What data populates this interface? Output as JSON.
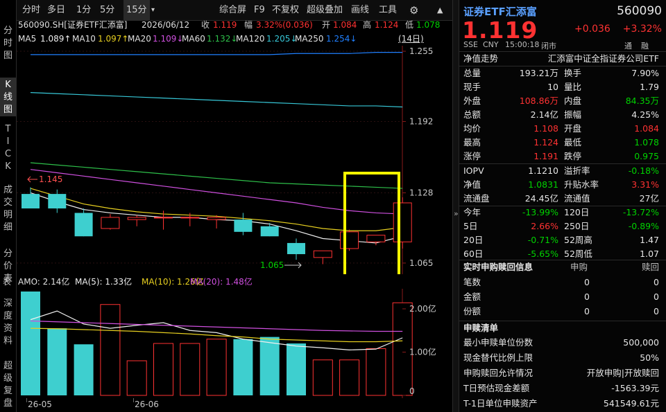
{
  "vtabs": [
    "分时图",
    "K线图",
    "TICK",
    "成交明细",
    "分价表",
    "深度资料",
    "超级复盘"
  ],
  "toolbar": {
    "items": [
      "分时",
      "多日",
      "1分",
      "5分",
      "15分",
      "▾",
      "综合屏",
      "F9",
      "不复权",
      "超级叠加",
      "画线",
      "工具"
    ],
    "gear": "⚙",
    "up": "▲"
  },
  "info": {
    "code": "560090.SH[证券ETF汇添富]",
    "date": "2026/06/12",
    "close_l": "收",
    "close": "1.119",
    "chg_l": "幅",
    "chg": "3.32%(0.036)",
    "open_l": "开",
    "open": "1.084",
    "high_l": "高",
    "high": "1.124",
    "low_l": "低",
    "low": "1.078"
  },
  "ma": {
    "ma5": "MA5",
    "ma5v": "1.089↑",
    "ma10": "MA10",
    "ma10v": "1.097↑",
    "ma20": "MA20",
    "ma20v": "1.109↓",
    "ma60": "MA60",
    "ma60v": "1.132↓",
    "ma120": "MA120",
    "ma120v": "1.205↓",
    "ma250": "MA250",
    "ma250v": "1.254↓",
    "days": "(14日)"
  },
  "price_axis": [
    "1.255",
    "1.192",
    "1.128",
    "1.065"
  ],
  "annot": {
    "hi": "1.145",
    "lo": "1.065"
  },
  "vol": {
    "amo": "AMO: 2.14亿",
    "ma5": "MA(5): 1.33亿",
    "ma10": "MA(10): 1.26亿",
    "ma20": "MA(20): 1.48亿",
    "axis": [
      "2.00亿",
      "1.00亿",
      "0"
    ]
  },
  "xaxis": [
    "26-05",
    "26-06"
  ],
  "chart_data": {
    "type": "candlestick",
    "y_range": [
      1.055,
      1.26
    ],
    "candles": [
      {
        "o": 1.127,
        "h": 1.133,
        "l": 1.117,
        "c": 1.114,
        "v": 2.4
      },
      {
        "o": 1.127,
        "h": 1.131,
        "l": 1.11,
        "c": 1.114,
        "v": 1.55
      },
      {
        "o": 1.11,
        "h": 1.114,
        "l": 1.089,
        "c": 1.089,
        "v": 1.18
      },
      {
        "o": 1.096,
        "h": 1.109,
        "l": 1.095,
        "c": 1.106,
        "v": 2.1
      },
      {
        "o": 1.104,
        "h": 1.108,
        "l": 1.098,
        "c": 1.106,
        "v": 0.8
      },
      {
        "o": 1.106,
        "h": 1.112,
        "l": 1.095,
        "c": 1.106,
        "v": 1.2
      },
      {
        "o": 1.106,
        "h": 1.11,
        "l": 1.098,
        "c": 1.106,
        "v": 1.2
      },
      {
        "o": 1.104,
        "h": 1.108,
        "l": 1.096,
        "c": 1.106,
        "v": 1.3
      },
      {
        "o": 1.104,
        "h": 1.11,
        "l": 1.09,
        "c": 1.093,
        "v": 1.3
      },
      {
        "o": 1.098,
        "h": 1.101,
        "l": 1.089,
        "c": 1.089,
        "v": 1.35
      },
      {
        "o": 1.083,
        "h": 1.087,
        "l": 1.068,
        "c": 1.073,
        "v": 1.2
      },
      {
        "o": 1.07,
        "h": 1.076,
        "l": 1.064,
        "c": 1.076,
        "v": 0.82
      },
      {
        "o": 1.078,
        "h": 1.095,
        "l": 1.076,
        "c": 1.093,
        "v": 0.82
      },
      {
        "o": 1.084,
        "h": 1.09,
        "l": 1.081,
        "c": 1.09,
        "v": 1.08
      },
      {
        "o": 1.084,
        "h": 1.124,
        "l": 1.078,
        "c": 1.119,
        "v": 2.14
      }
    ],
    "ma_lines": [
      {
        "name": "MA250",
        "color": "#2080ff",
        "values": [
          1.252,
          1.252,
          1.252,
          1.252,
          1.252,
          1.252,
          1.252,
          1.252,
          1.252,
          1.252,
          1.253,
          1.253,
          1.253,
          1.254,
          1.254
        ]
      },
      {
        "name": "MA120",
        "color": "#37c8d8",
        "values": [
          1.218,
          1.217,
          1.216,
          1.215,
          1.214,
          1.213,
          1.212,
          1.211,
          1.21,
          1.209,
          1.208,
          1.207,
          1.206,
          1.206,
          1.205
        ]
      },
      {
        "name": "MA60",
        "color": "#2ec04a",
        "values": [
          1.155,
          1.153,
          1.151,
          1.149,
          1.147,
          1.145,
          1.143,
          1.141,
          1.139,
          1.137,
          1.136,
          1.135,
          1.134,
          1.133,
          1.132
        ]
      },
      {
        "name": "MA20",
        "color": "#d050e0",
        "values": [
          1.149,
          1.146,
          1.143,
          1.14,
          1.137,
          1.134,
          1.131,
          1.128,
          1.125,
          1.122,
          1.119,
          1.115,
          1.112,
          1.11,
          1.109
        ]
      },
      {
        "name": "MA10",
        "color": "#e8d020",
        "values": [
          1.132,
          1.125,
          1.118,
          1.114,
          1.111,
          1.109,
          1.108,
          1.107,
          1.105,
          1.103,
          1.1,
          1.096,
          1.094,
          1.094,
          1.097
        ]
      },
      {
        "name": "MA5",
        "color": "#f0f0f0",
        "values": [
          1.128,
          1.12,
          1.113,
          1.11,
          1.108,
          1.106,
          1.106,
          1.104,
          1.103,
          1.1,
          1.094,
          1.087,
          1.085,
          1.083,
          1.089
        ]
      }
    ],
    "vol_ma": [
      {
        "name": "AMO-line",
        "color": "#f0f0f0",
        "values": [
          1.75,
          1.95,
          1.65,
          1.55,
          1.62,
          1.68,
          1.5,
          1.45,
          1.3,
          1.22,
          1.14,
          1.1,
          1.05,
          1.07,
          1.33
        ]
      },
      {
        "name": "MA10",
        "color": "#e8d020",
        "values": [
          1.55,
          1.54,
          1.52,
          1.5,
          1.48,
          1.45,
          1.42,
          1.38,
          1.35,
          1.3,
          1.28,
          1.26,
          1.24,
          1.24,
          1.26
        ]
      },
      {
        "name": "MA20",
        "color": "#d050e0",
        "values": [
          1.72,
          1.7,
          1.68,
          1.66,
          1.64,
          1.62,
          1.6,
          1.58,
          1.56,
          1.54,
          1.52,
          1.5,
          1.49,
          1.48,
          1.48
        ]
      }
    ],
    "vol_range": [
      0,
      2.4
    ]
  },
  "quote": {
    "name": "证券ETF汇添富",
    "code": "560090",
    "price": "1.119",
    "chg": "+0.036",
    "pct": "+3.32%",
    "ex": "SSE",
    "cur": "CNY",
    "time": "15:00:18",
    "status": "闭市",
    "tag1": "通",
    "tag2": "融"
  },
  "nav": {
    "label": "净值走势",
    "fund": "汇添富中证全指证券公司ETF"
  },
  "stats": [
    [
      {
        "l": "总量",
        "v": "193.21万",
        "c": "white"
      },
      {
        "l": "换手",
        "v": "7.90%",
        "c": "white"
      }
    ],
    [
      {
        "l": "现手",
        "v": "10",
        "c": "white"
      },
      {
        "l": "量比",
        "v": "1.79",
        "c": "white"
      }
    ],
    [
      {
        "l": "外盘",
        "v": "108.86万",
        "c": "red"
      },
      {
        "l": "内盘",
        "v": "84.35万",
        "c": "green"
      }
    ],
    [
      {
        "l": "总额",
        "v": "2.14亿",
        "c": "white"
      },
      {
        "l": "振幅",
        "v": "4.25%",
        "c": "white"
      }
    ],
    [
      {
        "l": "均价",
        "v": "1.108",
        "c": "red"
      },
      {
        "l": "开盘",
        "v": "1.084",
        "c": "red"
      }
    ],
    [
      {
        "l": "最高",
        "v": "1.124",
        "c": "red"
      },
      {
        "l": "最低",
        "v": "1.078",
        "c": "green"
      }
    ],
    [
      {
        "l": "涨停",
        "v": "1.191",
        "c": "red"
      },
      {
        "l": "跌停",
        "v": "0.975",
        "c": "green"
      }
    ]
  ],
  "stats2": [
    [
      {
        "l": "IOPV",
        "v": "1.1210",
        "c": "white"
      },
      {
        "l": "溢折率",
        "v": "-0.18%",
        "c": "green"
      }
    ],
    [
      {
        "l": "净值",
        "v": "1.0831",
        "c": "green"
      },
      {
        "l": "升贴水率",
        "v": "3.31%",
        "c": "red"
      }
    ],
    [
      {
        "l": "流通盘",
        "v": "24.45亿",
        "c": "white"
      },
      {
        "l": "流通值",
        "v": "27亿",
        "c": "white"
      }
    ]
  ],
  "stats3": [
    [
      {
        "l": "今年",
        "v": "-13.99%",
        "c": "green"
      },
      {
        "l": "120日",
        "v": "-13.72%",
        "c": "green"
      }
    ],
    [
      {
        "l": "5日",
        "v": "2.66%",
        "c": "red"
      },
      {
        "l": "250日",
        "v": "-0.89%",
        "c": "green"
      }
    ],
    [
      {
        "l": "20日",
        "v": "-0.71%",
        "c": "green"
      },
      {
        "l": "52周高",
        "v": "1.47",
        "c": "white"
      }
    ],
    [
      {
        "l": "60日",
        "v": "-5.65%",
        "c": "green"
      },
      {
        "l": "52周低",
        "v": "1.07",
        "c": "white"
      }
    ]
  ],
  "redeem": {
    "title": "实时申购赎回信息",
    "h1": "申购",
    "h2": "赎回",
    "rows": [
      {
        "l": "笔数",
        "a": "0",
        "b": "0"
      },
      {
        "l": "金额",
        "a": "0",
        "b": "0"
      },
      {
        "l": "份额",
        "a": "0",
        "b": "0"
      }
    ]
  },
  "list": {
    "title": "申赎清单",
    "rows": [
      {
        "l": "最小申赎单位份数",
        "v": "500,000"
      },
      {
        "l": "现金替代比例上限",
        "v": "50%"
      },
      {
        "l": "申购赎回允许情况",
        "v": "开放申购|开放赎回"
      },
      {
        "l": "T日预估现金差额",
        "v": "-1563.39元"
      },
      {
        "l": "T-1日单位申赎资产",
        "v": "541549.61元"
      }
    ]
  }
}
